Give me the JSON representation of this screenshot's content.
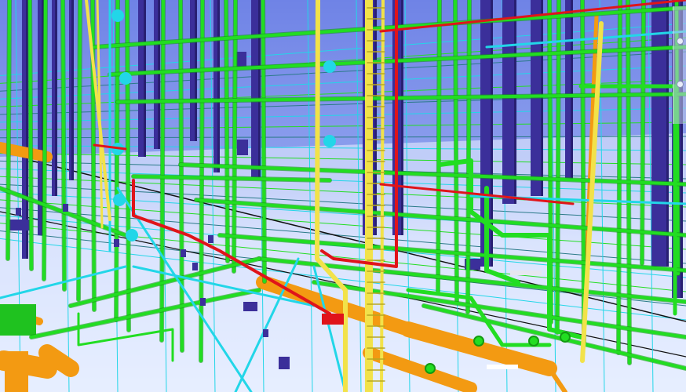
{
  "viewer": {
    "background_top": "#6f83e6",
    "background_bottom": "#e9efff",
    "floor_color": "#eef4ff"
  },
  "palette": {
    "water_pipe": "#22dd22",
    "water_pipe_dark": "#129a12",
    "cold_line": "#22d6e8",
    "power_cable_tray": "#f2e24a",
    "fire_line": "#e0141a",
    "duct_orange": "#f39a12",
    "riser_column": "#3b2f9a",
    "riser_column_dark": "#281f72",
    "black_line": "#111111"
  },
  "icons": {
    "nav_strip": "viewcube-nav-icon"
  }
}
